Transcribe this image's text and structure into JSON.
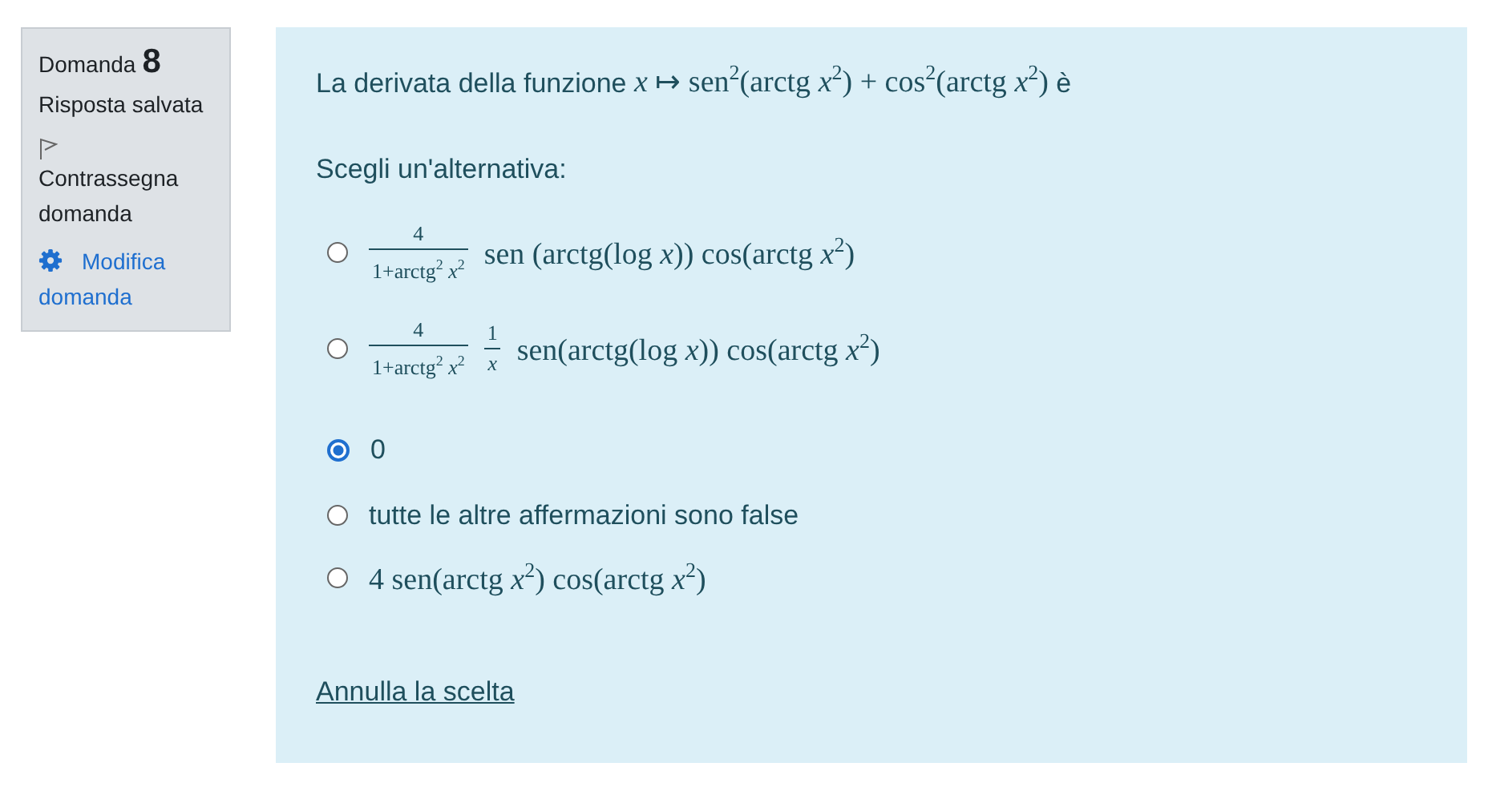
{
  "info": {
    "label": "Domanda",
    "number": "8",
    "status": "Risposta salvata",
    "flag": "Contrassegna domanda",
    "edit": "Modifica domanda"
  },
  "question": {
    "text": "La derivata della funzione",
    "formula": "*x* ↦ sen$^{2}$(arctg *x*$^{2}$) + cos$^{2}$(arctg *x*$^{2}$)",
    "text_after": "è"
  },
  "prompt": "Scegli un'alternativa:",
  "options": [
    {
      "kind": "formula",
      "selected": false,
      "fractions": [
        {
          "numerator": "4",
          "denominator": "1+arctg$^{2}$ *x*$^{2}$"
        }
      ],
      "label": "sen (arctg(log *x*)) cos(arctg *x*$^{2}$)"
    },
    {
      "kind": "formula",
      "selected": false,
      "fractions": [
        {
          "numerator": "4",
          "denominator": "1+arctg$^{2}$ *x*$^{2}$"
        },
        {
          "numerator": "1",
          "denominator": "*x*"
        }
      ],
      "label": "sen(arctg(log *x*)) cos(arctg *x*$^{2}$)"
    },
    {
      "kind": "text",
      "selected": true,
      "label": "0"
    },
    {
      "kind": "text",
      "selected": false,
      "label": "tutte le altre affermazioni sono false"
    },
    {
      "kind": "formula",
      "selected": false,
      "label": "4 sen(arctg *x*$^{2}$) cos(arctg *x*$^{2}$)"
    }
  ],
  "clear_link": "Annulla la scelta"
}
